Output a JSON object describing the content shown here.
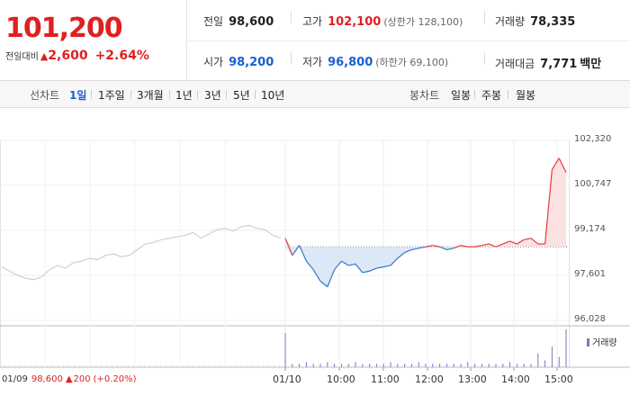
{
  "header": {
    "price": "101,200",
    "change_label": "전일대비",
    "change_arrow": "▲",
    "change_value": "2,600",
    "change_pct": "+2.64%"
  },
  "stats": {
    "prev_close_label": "전일",
    "prev_close": "98,600",
    "high_label": "고가",
    "high": "102,100",
    "upper_limit": "(상한가 128,100)",
    "volume_label": "거래량",
    "volume": "78,335",
    "open_label": "시가",
    "open": "98,200",
    "low_label": "저가",
    "low": "96,800",
    "lower_limit": "(하한가 69,100)",
    "amount_label": "거래대금",
    "amount": "7,771",
    "amount_unit": "백만"
  },
  "tabs": {
    "line_label": "선차트",
    "line_items": [
      "1일",
      "1주일",
      "3개월",
      "1년",
      "3년",
      "5년",
      "10년"
    ],
    "active_line": "1일",
    "candle_label": "봉차트",
    "candle_items": [
      "일봉",
      "주봉",
      "월봉"
    ]
  },
  "bottom": {
    "prev_date": "01/09",
    "prev_price": "98,600",
    "prev_arrow": "▲",
    "prev_change": "200",
    "prev_pct": "(+0.20%)",
    "volume_legend": "거래량"
  },
  "chart_data": {
    "type": "line",
    "title": "",
    "xlabel": "",
    "ylabel": "",
    "y_ticks": [
      "102,320",
      "100,747",
      "99,174",
      "97,601",
      "96,028"
    ],
    "ylim": [
      96028,
      102320
    ],
    "x_ticks": [
      "01/10",
      "10:00",
      "11:00",
      "12:00",
      "13:00",
      "14:00",
      "15:00"
    ],
    "reference_price": 98600,
    "series": [
      {
        "key": "prev_day",
        "color": "#c8c8c8",
        "values": [
          97900,
          97750,
          97600,
          97500,
          97450,
          97550,
          97800,
          97950,
          97850,
          98050,
          98100,
          98200,
          98150,
          98300,
          98350,
          98250,
          98300,
          98500,
          98700,
          98750,
          98850,
          98900,
          98950,
          99000,
          99100,
          98900,
          99050,
          99200,
          99250,
          99150,
          99300,
          99350,
          99250,
          99200,
          99000,
          98900
        ]
      },
      {
        "key": "today",
        "color_up": "#e83a3a",
        "color_down": "#3a74cc",
        "values": [
          98900,
          98300,
          98650,
          98100,
          97800,
          97400,
          97200,
          97800,
          98100,
          97950,
          98000,
          97700,
          97750,
          97850,
          97900,
          97950,
          98200,
          98400,
          98500,
          98550,
          98600,
          98650,
          98600,
          98500,
          98550,
          98650,
          98600,
          98600,
          98650,
          98700,
          98600,
          98700,
          98800,
          98700,
          98850,
          98900,
          98700,
          98700,
          101300,
          101700,
          101200
        ]
      }
    ],
    "volume": [
      20,
      2,
      2,
      3,
      2,
      2,
      3,
      2,
      2,
      2,
      3,
      2,
      2,
      2,
      2,
      3,
      2,
      2,
      2,
      3,
      2,
      2,
      2,
      2,
      2,
      2,
      3,
      2,
      2,
      2,
      2,
      2,
      3,
      2,
      2,
      2,
      8,
      4,
      12,
      6,
      22
    ]
  }
}
